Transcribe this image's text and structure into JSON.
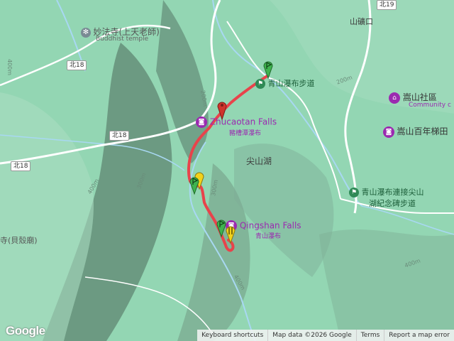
{
  "labels": {
    "temple_cn": "妙法寺(上天老師)",
    "temple_en": "Buddhist temple",
    "shankuang": "山礦口",
    "trail_start": "青山瀑布步道",
    "zhucaotan_en": "Zhucaotan Falls",
    "zhucaotan_cn": "豬槽潭瀑布",
    "songshan_community": "嵩山社區",
    "community_en": "Community c",
    "songshan_terrace": "嵩山百年梯田",
    "jianshanhu": "尖山湖",
    "trail_link": "青山瀑布連接尖山",
    "trail_link2": "湖紀念碑步道",
    "qingshan_en": "Qingshan Falls",
    "qingshan_cn": "青山瀑布",
    "beike_temple": "寺(貝殼廟)"
  },
  "roads": {
    "r1": "北18",
    "r2": "北18",
    "r3": "北18",
    "r4": "北19"
  },
  "contours": {
    "c1": "400m",
    "c2": "200m",
    "c3": "400m",
    "c4": "300m",
    "c5": "300m",
    "c6": "400m",
    "c7": "200m",
    "c8": "400m"
  },
  "footer": {
    "keyboard": "Keyboard shortcuts",
    "map_data": "Map data ©2026 Google",
    "terms": "Terms",
    "report": "Report a map error"
  },
  "brand": "Google",
  "colors": {
    "track": "#e8434b",
    "poi_purple": "#9b2ab0",
    "marker_green": "#3fb34f",
    "marker_yellow": "#f2d21b",
    "marker_red": "#d0342c"
  }
}
